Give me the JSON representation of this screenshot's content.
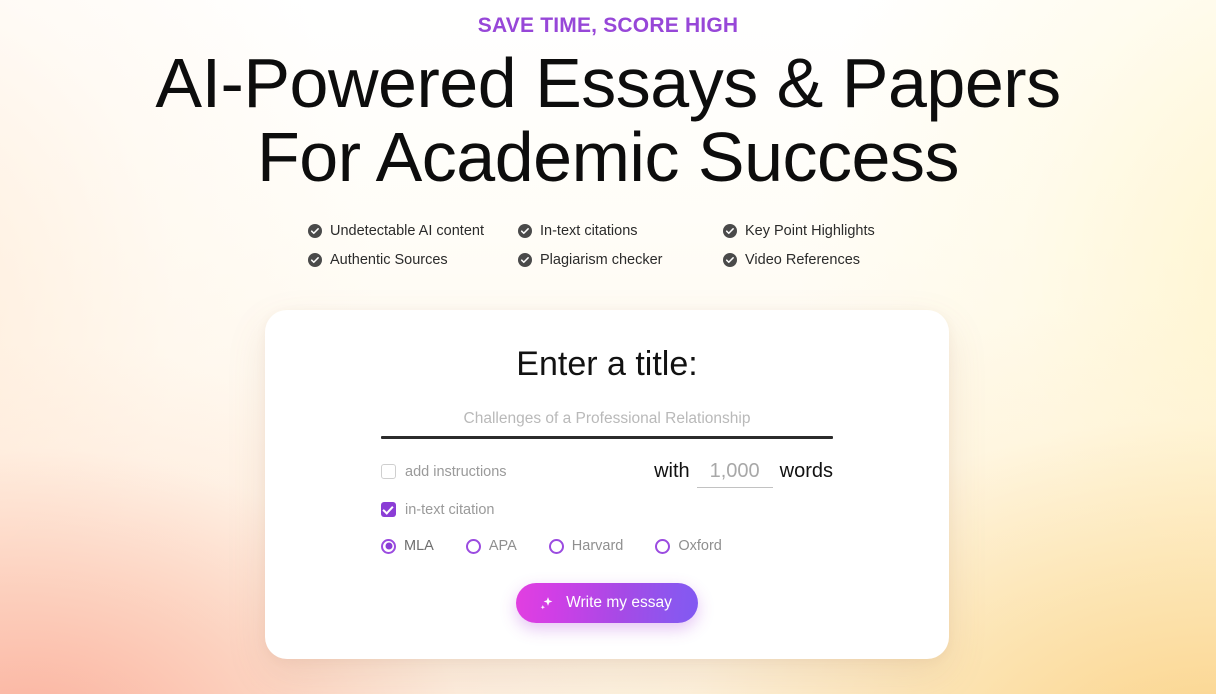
{
  "theme": {
    "accent_purple": "#9747d8",
    "checkbox_purple": "#8b3dd6",
    "radio_purple": "#9b4be0",
    "headline_color": "#0d0d0d",
    "card_bg": "#ffffff",
    "cta_gradient_from": "#e23fe0",
    "cta_gradient_to": "#8159f2",
    "bg_bottom_left": "#facabc",
    "bg_bottom_right": "#fae0b0",
    "bg_top": "#ffffff"
  },
  "hero": {
    "eyebrow": "SAVE TIME, SCORE HIGH",
    "headline_line1": "AI-Powered Essays & Papers",
    "headline_line2": "For Academic Success"
  },
  "features": [
    {
      "icon": "check-circle-icon",
      "label": "Undetectable AI content"
    },
    {
      "icon": "check-circle-icon",
      "label": "In-text citations"
    },
    {
      "icon": "check-circle-icon",
      "label": "Key Point Highlights"
    },
    {
      "icon": "check-circle-icon",
      "label": "Authentic Sources"
    },
    {
      "icon": "check-circle-icon",
      "label": "Plagiarism checker"
    },
    {
      "icon": "check-circle-icon",
      "label": "Video References"
    }
  ],
  "card": {
    "title": "Enter a title:",
    "title_input": {
      "value": "",
      "placeholder": "Challenges of a Professional Relationship"
    },
    "options": [
      {
        "id": "add-instructions",
        "label": "add instructions",
        "checked": false
      },
      {
        "id": "in-text-citation",
        "label": "in-text citation",
        "checked": true
      }
    ],
    "word_count": {
      "prefix_label": "with",
      "suffix_label": "words",
      "value": "",
      "placeholder": "1,000"
    },
    "citation_styles": {
      "selected": "MLA",
      "options": [
        {
          "label": "MLA",
          "selected": true
        },
        {
          "label": "APA",
          "selected": false
        },
        {
          "label": "Harvard",
          "selected": false
        },
        {
          "label": "Oxford",
          "selected": false
        }
      ]
    },
    "cta": {
      "icon": "sparkle-icon",
      "label": "Write my essay"
    }
  }
}
